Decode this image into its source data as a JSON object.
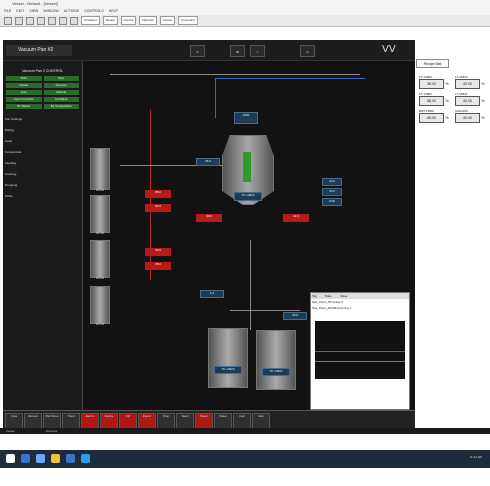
{
  "window": {
    "title": "Vessel - Default - [Vessel]"
  },
  "menu": [
    "FILE",
    "EDIT",
    "VIEW",
    "WINDOW",
    "ACTIONS",
    "CONTROLS",
    "HELP"
  ],
  "toolbar_tabs": [
    "Checkout",
    "Vessel",
    "Control",
    "Historian",
    "Vessel",
    "Command"
  ],
  "header": {
    "title": "Vacuum Pan #2",
    "stats": [
      "0",
      "48",
      "3",
      "Q"
    ]
  },
  "recipe_button": "Recipe Mat",
  "right_panel": {
    "rows": [
      {
        "tag": "FT-14800",
        "val": "38.00",
        "unit": "%"
      },
      {
        "tag": "LT-14800",
        "val": "40.00",
        "unit": "%"
      },
      {
        "tag": "FT-14802",
        "val": "88.00",
        "unit": "%"
      },
      {
        "tag": "LT-14803",
        "val": "40.00",
        "unit": "%"
      },
      {
        "tag": "BWT14800",
        "val": "85.00",
        "unit": "%"
      },
      {
        "tag": "ASA1480",
        "val": "40.00",
        "unit": "%"
      }
    ]
  },
  "left_panel": {
    "title": "Vacuum Pan 2 CONTROL",
    "buttons": [
      "Start",
      "Stop",
      "Pause",
      "Resume",
      "Auto",
      "Manual",
      "Open Controls",
      "Cut Back",
      "By Steam",
      "By Temperature"
    ],
    "sections": [
      "Pan Settings",
      "Boiling",
      "Grain",
      "Concentrate",
      "Seeding",
      "Graining",
      "Dropping",
      "Strike"
    ]
  },
  "tanks": {
    "main": "TK 14800",
    "bottom_left": "TK 14820",
    "bottom_right": "TK 14821",
    "side": [
      "ST-01",
      "ST-02",
      "ST-03",
      "ST-04"
    ]
  },
  "red_values": [
    "85.0",
    "30.0",
    "40.0",
    "35.0",
    "32.0",
    "30.0"
  ],
  "blue_values": [
    "25.0",
    "22.0",
    "40.0",
    "1000",
    "6.00",
    "1.0",
    "30.0"
  ],
  "trend": {
    "title": "Alarms",
    "columns": [
      "Tag",
      "State",
      "Value"
    ],
    "rows": [
      [
        "Seq_Pan2_SP",
        "Active",
        "0"
      ],
      [
        "Seq_Pan2_MODE",
        "Running",
        "1"
      ]
    ]
  },
  "bottom_buttons": [
    "Area",
    "Vacuum",
    "Pan Menu",
    "Trend",
    "Alarms",
    "Recipe",
    "Ctrl",
    "Report",
    "Drop",
    "Seed",
    "Steam",
    "Water",
    "Cool",
    "Help"
  ],
  "status": {
    "user": "Vessel",
    "state": "Operator",
    "time": "11:24 AM"
  },
  "colors": {
    "accent": "#2c6b2c",
    "alarm": "#b8191a",
    "tag": "#1f3c57",
    "pipe": "#2f6ac9"
  }
}
